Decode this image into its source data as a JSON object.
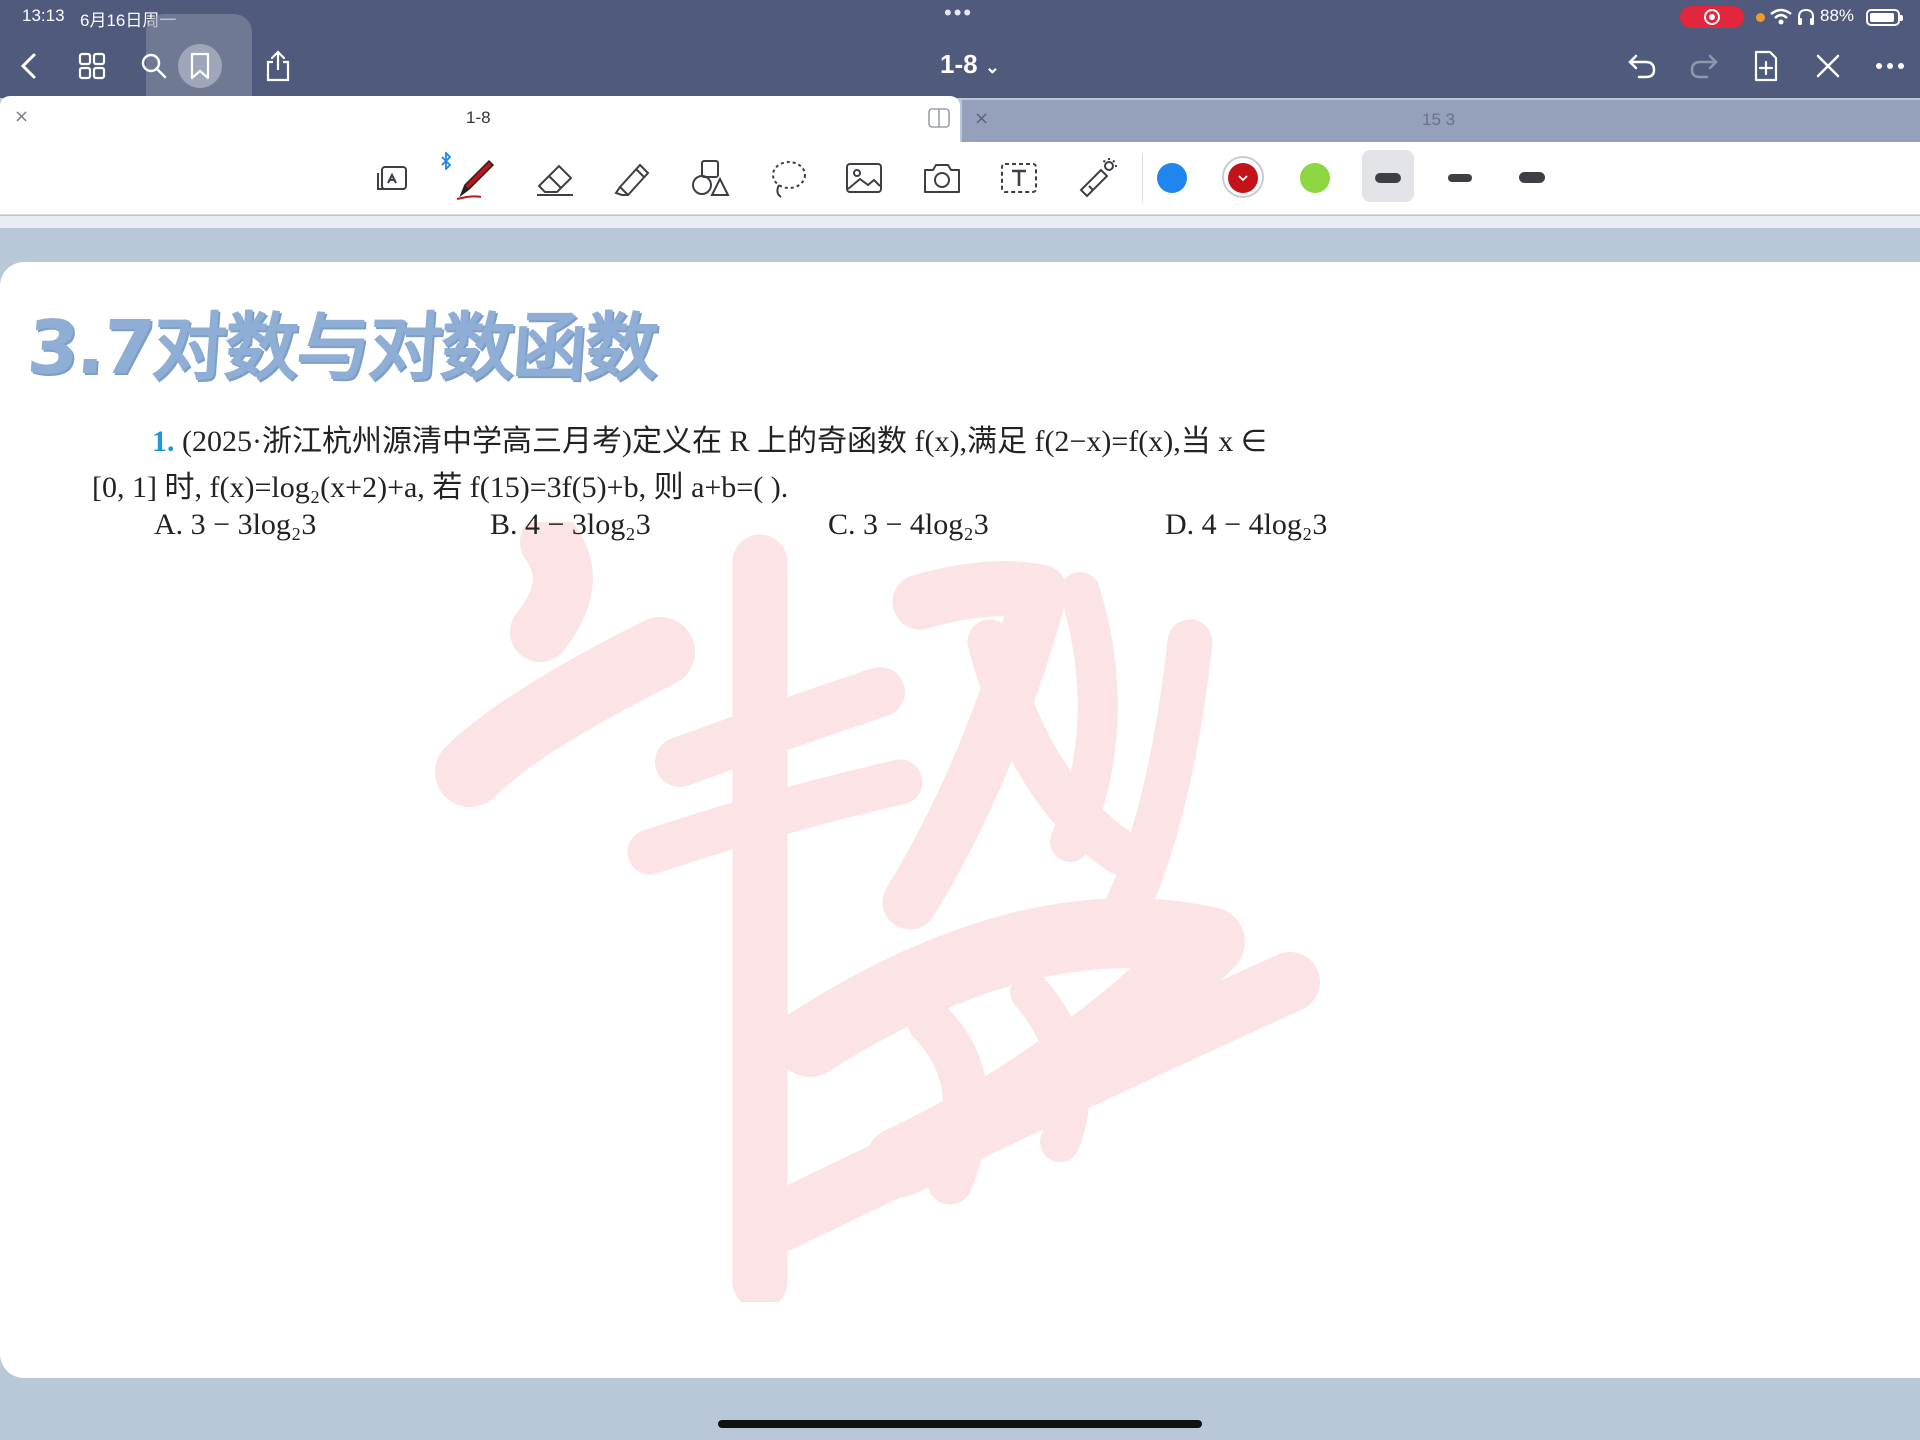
{
  "status_bar": {
    "time": "13:13",
    "date": "6月16日周一",
    "center_dots": "•••",
    "battery_percent": "88%",
    "battery_level": 0.88
  },
  "header": {
    "document_title": "1-8",
    "title_chevron": "⌄",
    "left_icons": [
      "back-icon",
      "grid-icon",
      "search-icon",
      "bookmark-icon",
      "share-icon"
    ],
    "right_icons": [
      "undo-icon",
      "redo-icon",
      "add-page-icon",
      "close-x-icon",
      "more-icon"
    ]
  },
  "tabs": [
    {
      "label": "1-8",
      "close": "×",
      "active": true
    },
    {
      "label": "15 3",
      "close": "×",
      "active": false
    }
  ],
  "toolbar": {
    "tools": [
      "read-mode-icon",
      "pen-icon",
      "eraser-icon",
      "highlighter-icon",
      "shapes-icon",
      "lasso-icon",
      "image-icon",
      "camera-icon",
      "text-box-icon",
      "laser-pointer-icon"
    ],
    "bluetooth_icon": "bluetooth-icon",
    "colors": [
      "#1f86f0",
      "#c4121b",
      "#8cd641"
    ],
    "selected_color": "#c4121b"
  },
  "document": {
    "section_title": "3.7对数与对数函数",
    "question": {
      "number": "1.",
      "line1": "(2025·浙江杭州源清中学高三月考)定义在 R 上的奇函数 f(x),满足 f(2−x)=f(x),当 x ∈",
      "line2": "[0, 1] 时, f(x)=log₂(x+2)+a, 若 f(15)=3f(5)+b, 则 a+b=(      ).",
      "options": [
        {
          "label": "A.",
          "text": "3 − 3log₂3"
        },
        {
          "label": "B.",
          "text": "4 − 3log₂3"
        },
        {
          "label": "C.",
          "text": "3 − 4log₂3"
        },
        {
          "label": "D.",
          "text": "4 − 4log₂3"
        }
      ]
    }
  }
}
